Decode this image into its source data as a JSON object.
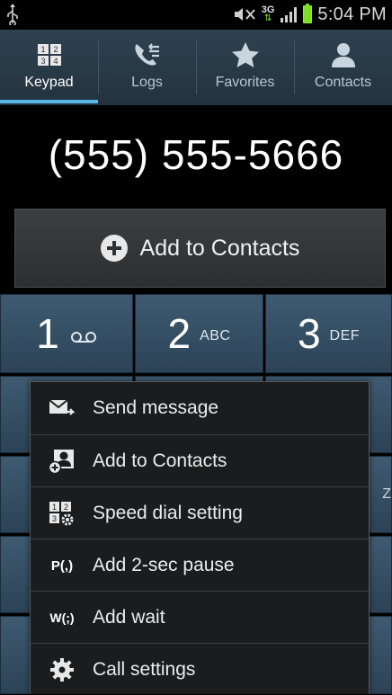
{
  "status_bar": {
    "time": "5:04 PM",
    "network_type": "3G",
    "icons": [
      "usb-icon",
      "mute-icon",
      "network-3g-icon",
      "signal-icon",
      "battery-icon"
    ]
  },
  "tabs": [
    {
      "label": "Keypad",
      "icon": "keypad-icon",
      "active": true
    },
    {
      "label": "Logs",
      "icon": "call-logs-icon",
      "active": false
    },
    {
      "label": "Favorites",
      "icon": "star-icon",
      "active": false
    },
    {
      "label": "Contacts",
      "icon": "person-icon",
      "active": false
    }
  ],
  "dialed_number": "(555) 555-5666",
  "add_to_contacts_button": {
    "label": "Add to Contacts",
    "icon": "plus-circle-icon"
  },
  "keypad": {
    "keys": [
      {
        "digit": "1",
        "letters": "",
        "icon": "voicemail-icon"
      },
      {
        "digit": "2",
        "letters": "ABC"
      },
      {
        "digit": "3",
        "letters": "DEF"
      }
    ],
    "partially_visible_letters": "Z"
  },
  "context_menu": {
    "items": [
      {
        "label": "Send message",
        "icon": "send-message-icon"
      },
      {
        "label": "Add to Contacts",
        "icon": "add-contact-icon"
      },
      {
        "label": "Speed dial setting",
        "icon": "speed-dial-icon"
      },
      {
        "label": "Add 2-sec pause",
        "icon_text": "P(,)"
      },
      {
        "label": "Add wait",
        "icon_text": "W(;)"
      },
      {
        "label": "Call settings",
        "icon": "gear-icon"
      }
    ]
  },
  "colors": {
    "tab_bar": "#2b3b48",
    "tab_active_indicator": "#59b7e6",
    "key_background": "#35506a",
    "battery": "#7be021"
  }
}
